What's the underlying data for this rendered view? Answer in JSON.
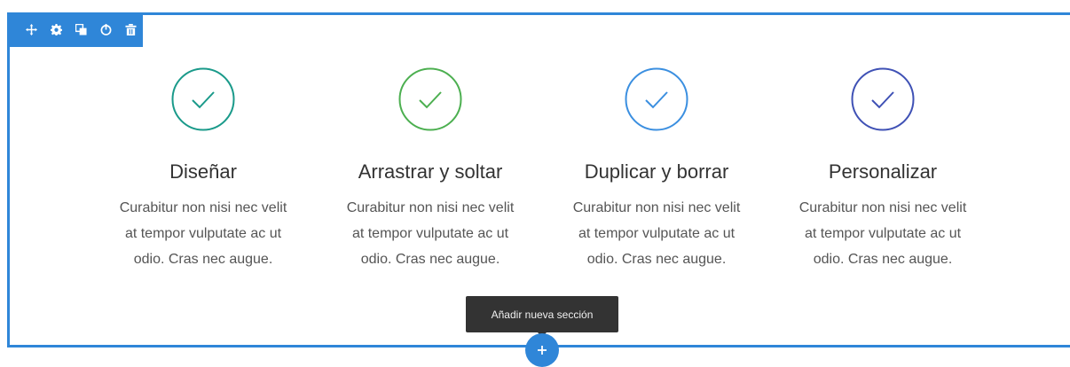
{
  "toolbar": {
    "items": [
      {
        "icon": "move-icon"
      },
      {
        "icon": "gear-icon"
      },
      {
        "icon": "duplicate-icon"
      },
      {
        "icon": "save-icon"
      },
      {
        "icon": "trash-icon"
      }
    ]
  },
  "features": [
    {
      "title": "Diseñar",
      "text": "Curabitur non nisi nec velit at tempor vulputate ac ut odio. Cras nec augue.",
      "color": "#1a9a8a",
      "icon": "check-circle-icon"
    },
    {
      "title": "Arrastrar y soltar",
      "text": "Curabitur non nisi nec velit at tempor vulputate ac ut odio. Cras nec augue.",
      "color": "#4caf50",
      "icon": "check-circle-icon"
    },
    {
      "title": "Duplicar y borrar",
      "text": "Curabitur non nisi nec velit at tempor vulputate ac ut odio. Cras nec augue.",
      "color": "#3b8fe0",
      "icon": "check-circle-icon"
    },
    {
      "title": "Personalizar",
      "text": "Curabitur non nisi nec velit at tempor vulputate ac ut odio. Cras nec augue.",
      "color": "#3f51b5",
      "icon": "check-circle-icon"
    }
  ],
  "tooltip": {
    "text": "Añadir nueva sección"
  },
  "add_section": {
    "icon": "plus-icon"
  },
  "colors": {
    "accent": "#2f86d8",
    "tooltip_bg": "#333333"
  }
}
